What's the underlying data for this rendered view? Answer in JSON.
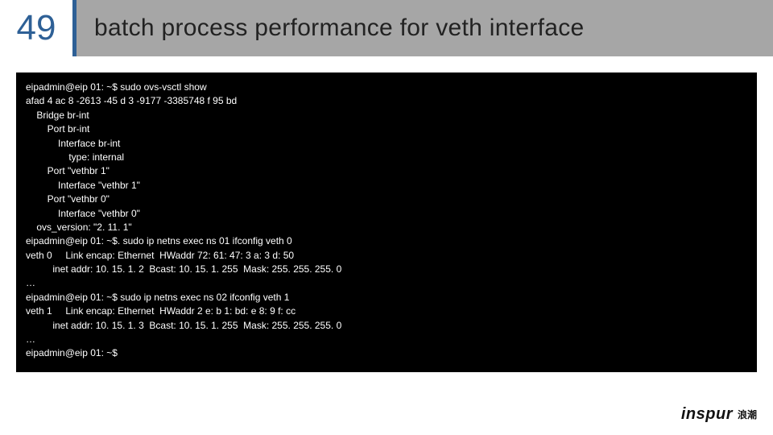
{
  "header": {
    "slide_number": "49",
    "title": "batch process performance for veth interface"
  },
  "terminal": {
    "lines": [
      "eipadmin@eip 01: ~$ sudo ovs-vsctl show",
      "afad 4 ac 8 -2613 -45 d 3 -9177 -3385748 f 95 bd",
      "    Bridge br-int",
      "        Port br-int",
      "            Interface br-int",
      "                type: internal",
      "        Port \"vethbr 1\"",
      "            Interface \"vethbr 1\"",
      "        Port \"vethbr 0\"",
      "            Interface \"vethbr 0\"",
      "    ovs_version: \"2. 11. 1\"",
      "eipadmin@eip 01: ~$. sudo ip netns exec ns 01 ifconfig veth 0",
      "veth 0     Link encap: Ethernet  HWaddr 72: 61: 47: 3 a: 3 d: 50",
      "          inet addr: 10. 15. 1. 2  Bcast: 10. 15. 1. 255  Mask: 255. 255. 255. 0",
      "…",
      "eipadmin@eip 01: ~$ sudo ip netns exec ns 02 ifconfig veth 1",
      "veth 1     Link encap: Ethernet  HWaddr 2 e: b 1: bd: e 8: 9 f: cc",
      "          inet addr: 10. 15. 1. 3  Bcast: 10. 15. 1. 255  Mask: 255. 255. 255. 0",
      "…",
      "eipadmin@eip 01: ~$"
    ]
  },
  "footer": {
    "logo_text": "inspur",
    "logo_cn": "浪潮"
  }
}
